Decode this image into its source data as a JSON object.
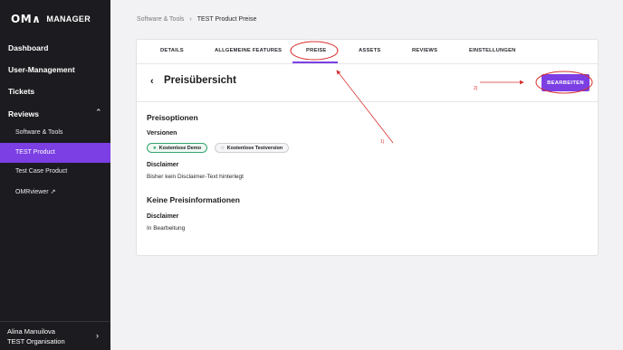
{
  "sidebar": {
    "logo_mark": "OM∧",
    "logo_text": "MANAGER",
    "items": [
      {
        "label": "Dashboard"
      },
      {
        "label": "User-Management"
      },
      {
        "label": "Tickets"
      },
      {
        "label": "Reviews"
      }
    ],
    "sub_items": [
      {
        "label": "Software & Tools"
      },
      {
        "label": "TEST Product"
      },
      {
        "label": "Test Case Product"
      },
      {
        "label": "OMRviewer"
      }
    ],
    "user": {
      "name": "Alina Manuilova",
      "org": "TEST Organisation"
    }
  },
  "breadcrumb": {
    "parent": "Software & Tools",
    "separator": "›",
    "current": "TEST Product Preise"
  },
  "tabs": [
    {
      "label": "DETAILS"
    },
    {
      "label": "ALLGEMEINE FEATURES"
    },
    {
      "label": "PREISE"
    },
    {
      "label": "ASSETS"
    },
    {
      "label": "REVIEWS"
    },
    {
      "label": "EINSTELLUNGEN"
    }
  ],
  "page": {
    "title": "Preisübersicht",
    "edit_label": "BEARBEITEN",
    "price_options_heading": "Preisoptionen",
    "versions_label": "Versionen",
    "badges": [
      {
        "label": "Kostenlose Demo"
      },
      {
        "label": "Kostenlose Testversion"
      }
    ],
    "disclaimer1_label": "Disclaimer",
    "disclaimer1_text": "Bisher kein Disclaimer-Text hinterlegt",
    "no_price_heading": "Keine Preisinformationen",
    "disclaimer2_label": "Disclaimer",
    "disclaimer2_text": "In Bearbeitung"
  },
  "annotations": {
    "label1": "1)",
    "label2": "2)",
    "color": "#d83030"
  },
  "colors": {
    "accent": "#7b3fe4",
    "sidebar_bg": "#1c1c20",
    "badge_green": "#34a56f"
  }
}
